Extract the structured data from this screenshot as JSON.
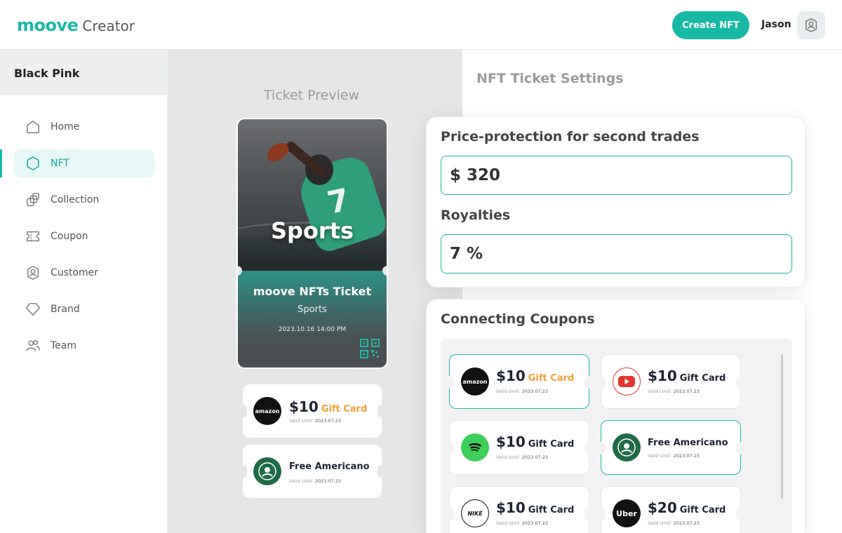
{
  "header": {
    "logo_mark": "moove",
    "logo_sub": "Creator",
    "create_button": "Create NFT",
    "user_name": "Jason"
  },
  "sidebar": {
    "project_name": "Black Pink",
    "items": [
      {
        "label": "Home",
        "icon": "home-icon",
        "active": false
      },
      {
        "label": "NFT",
        "icon": "hexagon-icon",
        "active": true
      },
      {
        "label": "Collection",
        "icon": "collection-icon",
        "active": false
      },
      {
        "label": "Coupon",
        "icon": "coupon-icon",
        "active": false
      },
      {
        "label": "Customer",
        "icon": "customer-icon",
        "active": false
      },
      {
        "label": "Brand",
        "icon": "brand-icon",
        "active": false
      },
      {
        "label": "Team",
        "icon": "team-icon",
        "active": false
      }
    ]
  },
  "preview": {
    "title": "Ticket Preview",
    "ticket": {
      "hero_text": "Sports",
      "jersey_number": "7",
      "name": "moove NFTs Ticket",
      "category": "Sports",
      "datetime": "2023.10.16 14:00 PM"
    },
    "coupons": [
      {
        "brand": "amazon",
        "amount": "$10",
        "type": "Gift Card",
        "valid_label": "Valid Until",
        "valid_date": "2023.07.23"
      },
      {
        "brand": "starbucks",
        "title": "Free Americano",
        "valid_label": "Valid Until",
        "valid_date": "2023.07.23"
      }
    ]
  },
  "settings": {
    "title": "NFT Ticket Settings",
    "price_protection_label": "Price-protection for second trades",
    "price_protection_value": "$ 320",
    "royalties_label": "Royalties",
    "royalties_value": "7 %",
    "connecting_coupons_label": "Connecting Coupons",
    "coupons": [
      {
        "brand": "amazon",
        "amount": "$10",
        "type": "Gift Card",
        "type_color": "orange",
        "valid_label": "Valid Until",
        "valid_date": "2023.07.23",
        "selected": true
      },
      {
        "brand": "youtube",
        "amount": "$10",
        "type": "Gift Card",
        "type_color": "dark",
        "valid_label": "Valid Until",
        "valid_date": "2023.07.23",
        "selected": false
      },
      {
        "brand": "spotify",
        "amount": "$10",
        "type": "Gift Card",
        "type_color": "dark",
        "valid_label": "Valid Until",
        "valid_date": "2023.07.23",
        "selected": false
      },
      {
        "brand": "starbucks",
        "title": "Free Americano",
        "valid_label": "Valid Until",
        "valid_date": "2023.07.23",
        "selected": true
      },
      {
        "brand": "nike",
        "amount": "$10",
        "type": "Gift Card",
        "type_color": "dark",
        "valid_label": "Valid Until",
        "valid_date": "2023.07.23",
        "selected": false
      },
      {
        "brand": "uber",
        "amount": "$20",
        "type": "Gift Card",
        "type_color": "dark",
        "valid_label": "Valid Until",
        "valid_date": "2023.07.23",
        "selected": false
      }
    ],
    "brand_labels": {
      "amazon": "amazon",
      "nike": "NIKE",
      "uber": "Uber"
    }
  },
  "colors": {
    "accent": "#16b8a6",
    "accent_light": "#e6f7f5",
    "gift_orange": "#f0a131",
    "text_dark": "#1f2433"
  }
}
